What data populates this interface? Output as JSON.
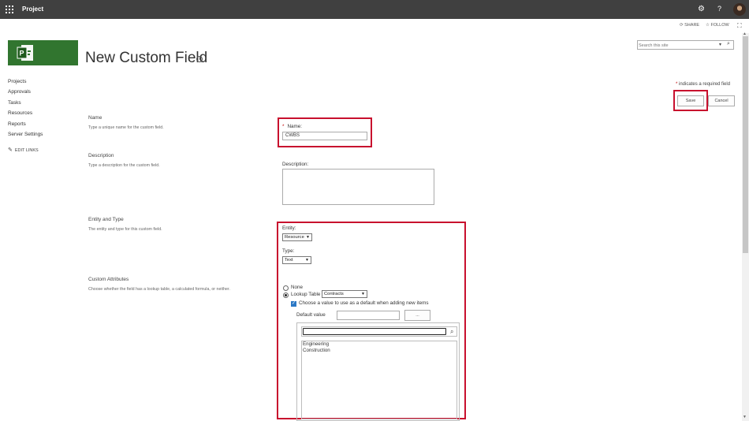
{
  "suite": {
    "app_title": "Project",
    "icons": [
      "waffle-icon",
      "gear-icon",
      "help-icon",
      "avatar"
    ]
  },
  "actions": {
    "share": "SHARE",
    "follow": "FOLLOW"
  },
  "search": {
    "placeholder": "Search this site"
  },
  "page": {
    "title": "New Custom Field"
  },
  "nav": {
    "items": [
      "Projects",
      "Approvals",
      "Tasks",
      "Resources",
      "Reports",
      "Server Settings"
    ],
    "edit_links": "EDIT LINKS"
  },
  "form": {
    "required_note": "indicates a required field",
    "required_star": "*",
    "save_label": "Save",
    "cancel_label": "Cancel",
    "name_section": {
      "title": "Name",
      "description": "Type a unique name for the custom field.",
      "field_label": "Name:",
      "field_value": "CWBS"
    },
    "description_section": {
      "title": "Description",
      "description": "Type a description for the custom field.",
      "field_label": "Description:",
      "field_value": ""
    },
    "entity_section": {
      "title": "Entity and Type",
      "description": "The entity and type for this custom field.",
      "entity_label": "Entity:",
      "entity_value": "Resource",
      "type_label": "Type:",
      "type_value": "Text"
    },
    "attributes_section": {
      "title": "Custom Attributes",
      "description": "Choose whether the field has a lookup table, a calculated formula, or neither.",
      "none_label": "None",
      "none_selected": false,
      "lookup_label": "Lookup Table",
      "lookup_selected": true,
      "lookup_value": "Contracts",
      "default_checkbox_label": "Choose a value to use as a default when adding new items",
      "default_checked": true,
      "default_value_label": "Default value",
      "default_value": "",
      "ellipsis_label": "...",
      "lookup_search_value": "",
      "lookup_items": [
        "Engineering",
        "Construction"
      ]
    }
  },
  "colors": {
    "suite_bar": "#404040",
    "logo_green": "#31752f",
    "highlight_red": "#c8102e",
    "required_star": "#bf0000",
    "checkbox_blue": "#2b78c5"
  }
}
